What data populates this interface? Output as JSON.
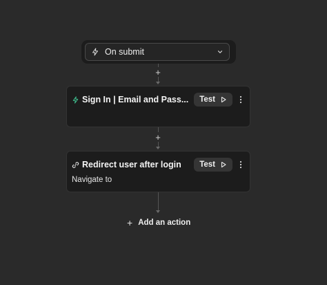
{
  "trigger": {
    "label": "On submit",
    "icon": "lightning-icon"
  },
  "actions": [
    {
      "title": "Sign In | Email and Pass...",
      "icon": "lightning-icon",
      "icon_color": "#3fbf8f",
      "test_label": "Test",
      "subtitle": ""
    },
    {
      "title": "Redirect user after login",
      "icon": "link-icon",
      "icon_color": "#e6e6e6",
      "test_label": "Test",
      "subtitle": "Navigate to"
    }
  ],
  "add_action": {
    "label": "Add an action"
  },
  "colors": {
    "background": "#2a2a2a",
    "card": "#1c1c1c",
    "accent": "#3fbf8f"
  }
}
